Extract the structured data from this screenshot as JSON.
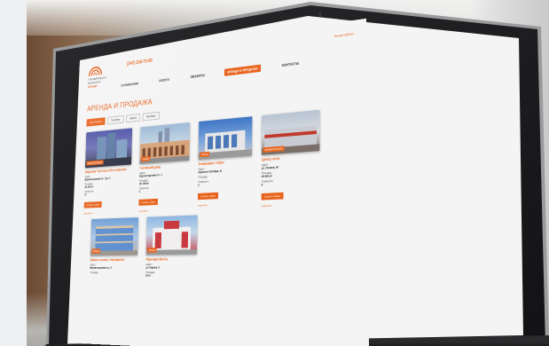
{
  "site": {
    "phone": "(347) 256-75-55",
    "logo_lines": [
      "УПРАВЛЯЮЩАЯ",
      "КОМПАНИЯ",
      "АРЕНДА"
    ],
    "personal_link": "Личный кабинет",
    "nav": [
      "О КОМПАНИИ",
      "УСЛУГИ",
      "ОБЪЕКТЫ",
      "АРЕНДА И ПРОДАЖА",
      "КОНТАКТЫ"
    ],
    "active_nav_index": 3,
    "page_title": "АРЕНДА И ПРОДАЖА",
    "filters": [
      "Все объекты",
      "Торговые",
      "Офисы",
      "Торговые"
    ],
    "active_filter_index": 0,
    "cards": [
      {
        "badge": "АРЕНДА/ПРОДАЖА",
        "title": "Верхняя Торговая Ярославская",
        "address_label": "Адрес:",
        "address": "Верхнеторговая пл., стр. 5",
        "area_label": "Площадь:",
        "area": "35–300 м²",
        "price_label": "Этажность:",
        "price": "27",
        "button": "Оставить заявку",
        "link": "подробнее"
      },
      {
        "badge": "АРЕНДА",
        "title": "Гостиный двор",
        "address_label": "Адрес:",
        "address": "Верхнеторговая пл., 1",
        "area_label": "Площадь:",
        "area": "35–750 м²",
        "price_label": "Этажность:",
        "price": "2",
        "button": "Оставить заявку",
        "link": "подробнее"
      },
      {
        "badge": "АРЕНДА",
        "title": "Универмаг «Уфа»",
        "address_label": "Адрес:",
        "address": "Проспект Октября, 31",
        "area_label": "Площадь:",
        "area": "",
        "price_label": "Этажность:",
        "price": "3",
        "button": "Оставить заявку",
        "link": "подробнее"
      },
      {
        "badge": "АРЕНДА/ПРОДАЖА",
        "title": "Центр сити",
        "address_label": "Адрес:",
        "address": "ул. Ленина, 30",
        "area_label": "Площадь:",
        "area": "35 000 м²",
        "price_label": "Этажность:",
        "price": "6",
        "button": "Оставить заявку",
        "link": "подробнее"
      },
      {
        "badge": "АРЕНДА",
        "title": "Бизнес-центр «Нагорная»",
        "address_label": "Адрес:",
        "address": "Верхнеторговая пл., 5",
        "area_label": "Площадь:",
        "area": "",
        "price_label": "",
        "price": "",
        "button": "",
        "link": ""
      },
      {
        "badge": "АРЕНДА",
        "title": "Принцип Веста",
        "address_label": "Адрес:",
        "address": "ул. Кирова, 5",
        "area_label": "Площадь:",
        "area": "20 м²",
        "price_label": "",
        "price": "",
        "button": "",
        "link": ""
      }
    ]
  },
  "colors": {
    "accent": "#e8641d",
    "page_bg": "#f4f4f4",
    "bezel": "#1b1b1d"
  }
}
